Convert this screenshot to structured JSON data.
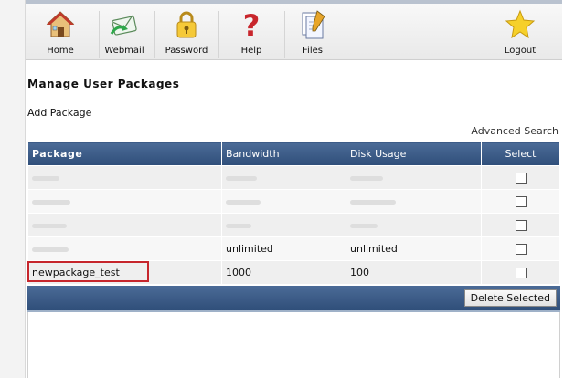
{
  "toolbar": {
    "home": "Home",
    "webmail": "Webmail",
    "password": "Password",
    "help": "Help",
    "files": "Files",
    "logout": "Logout"
  },
  "page": {
    "title": "Manage User Packages",
    "add_package": "Add Package",
    "advanced_search": "Advanced Search"
  },
  "table": {
    "headers": [
      "Package",
      "Bandwidth",
      "Disk Usage",
      "Select"
    ],
    "rows": [
      {
        "package": "",
        "bandwidth": "",
        "disk": ""
      },
      {
        "package": "",
        "bandwidth": "",
        "disk": ""
      },
      {
        "package": "",
        "bandwidth": "",
        "disk": ""
      },
      {
        "package": "",
        "bandwidth": "unlimited",
        "disk": "unlimited"
      },
      {
        "package": "newpackage_test",
        "bandwidth": "1000",
        "disk": "100"
      }
    ]
  },
  "actions": {
    "delete_selected": "Delete Selected"
  },
  "colors": {
    "header_blue": "#3a5a86",
    "highlight_red": "#c6262c"
  }
}
